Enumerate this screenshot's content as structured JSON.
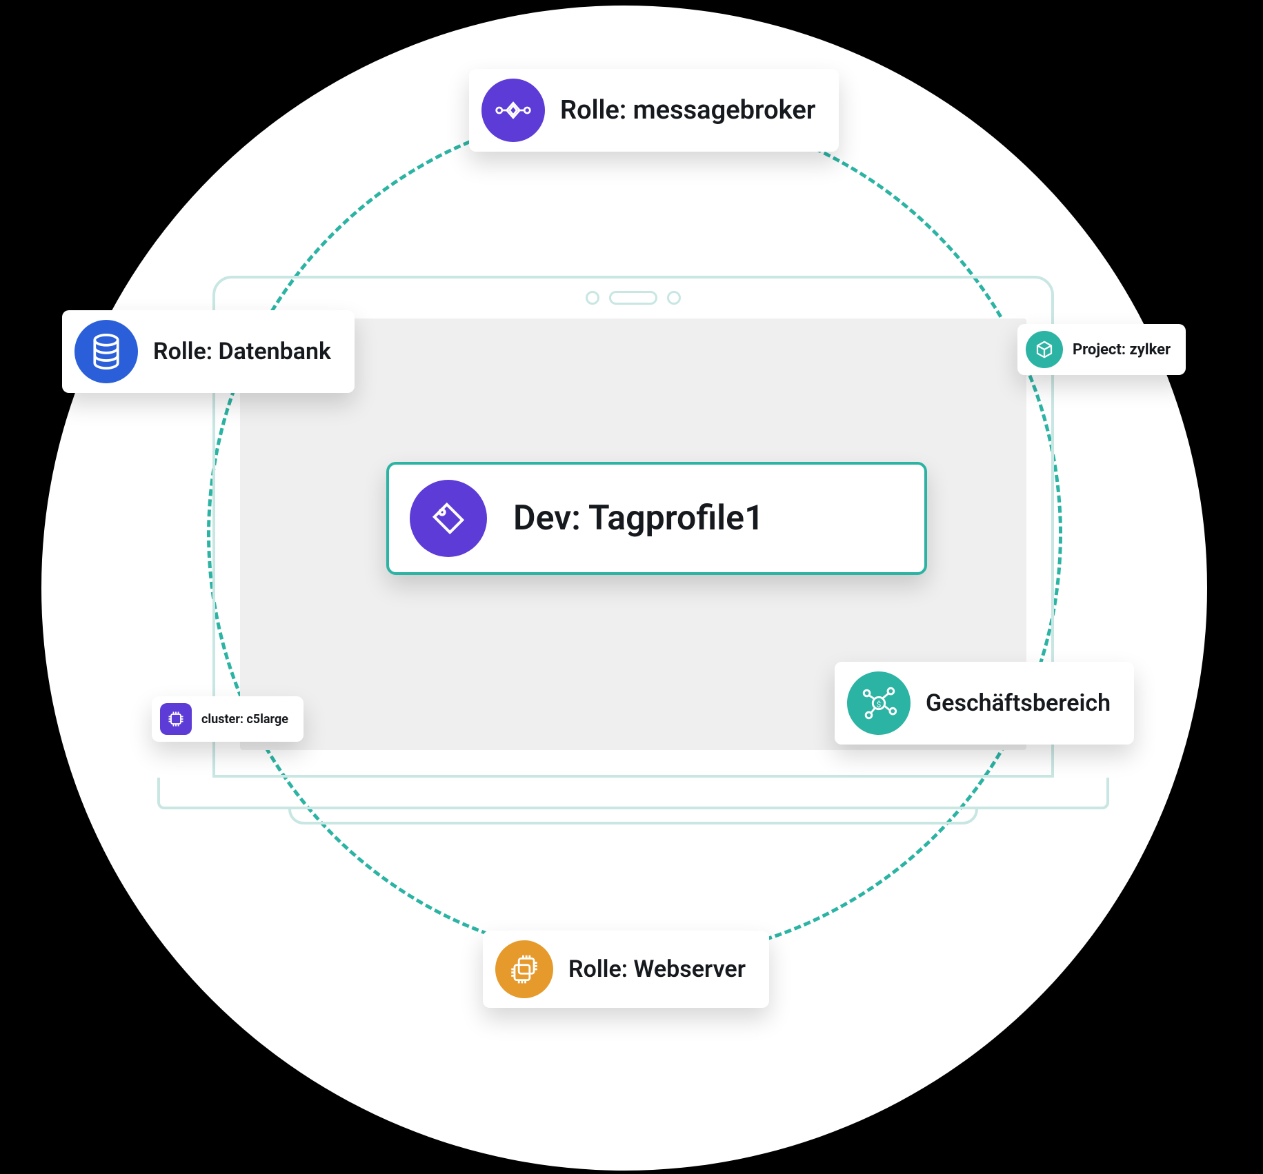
{
  "center": {
    "label": "Dev: Tagprofile1"
  },
  "nodes": {
    "messagebroker": {
      "label": "Rolle: messagebroker"
    },
    "database": {
      "label": "Rolle: Datenbank"
    },
    "project": {
      "label": "Project: zylker"
    },
    "cluster": {
      "label": "cluster: c5large"
    },
    "business": {
      "label": "Geschäftsbereich"
    },
    "webserver": {
      "label": "Rolle: Webserver"
    }
  },
  "colors": {
    "purple": "#5d3bd6",
    "blue": "#2b5fd9",
    "teal": "#2bb3a3",
    "orange": "#e69a2b"
  }
}
